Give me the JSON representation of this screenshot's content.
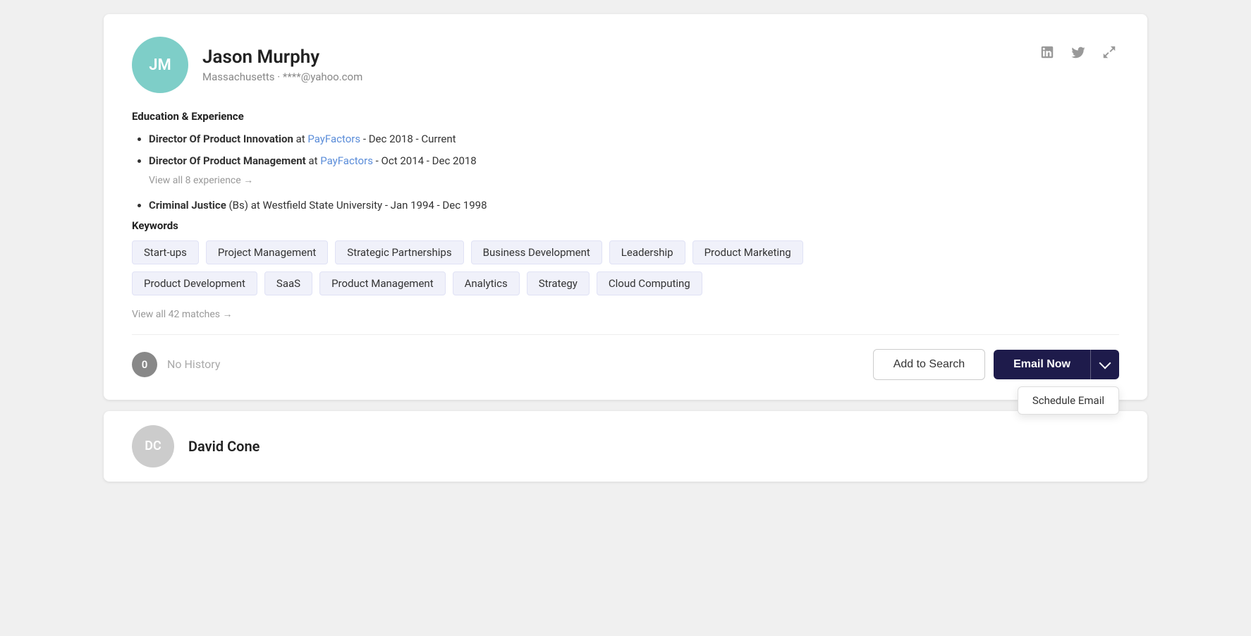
{
  "profile": {
    "initials": "JM",
    "name": "Jason Murphy",
    "location": "Massachusetts",
    "email": "****@yahoo.com",
    "meta": "Massachusetts · ****@yahoo.com",
    "avatar_color": "#7ecec8",
    "education_experience_title": "Education & Experience",
    "experiences": [
      {
        "title": "Director Of Product Innovation",
        "company": "PayFactors",
        "date_range": "Dec 2018 - Current"
      },
      {
        "title": "Director Of Product Management",
        "company": "PayFactors",
        "date_range": "Oct 2014 - Dec 2018"
      }
    ],
    "view_all_experience_label": "View all 8 experience →",
    "education": [
      {
        "degree": "Criminal Justice",
        "level": "Bs",
        "institution": "Westfield State University",
        "date_range": "Jan 1994 - Dec 1998"
      }
    ],
    "keywords_title": "Keywords",
    "keywords": [
      "Start-ups",
      "Project Management",
      "Strategic Partnerships",
      "Business Development",
      "Leadership",
      "Product Marketing",
      "Product Development",
      "SaaS",
      "Product Management",
      "Analytics",
      "Strategy",
      "Cloud Computing"
    ],
    "view_matches_label": "View all 42 matches →",
    "history_count": "0",
    "no_history_label": "No History",
    "add_to_search_label": "Add to Search",
    "email_now_label": "Email Now",
    "schedule_email_label": "Schedule Email"
  },
  "second_profile": {
    "initials": "DC",
    "name": "David Cone",
    "avatar_color": "#ccc"
  },
  "icons": {
    "linkedin": "in",
    "twitter": "🐦",
    "expand": "⤢"
  }
}
